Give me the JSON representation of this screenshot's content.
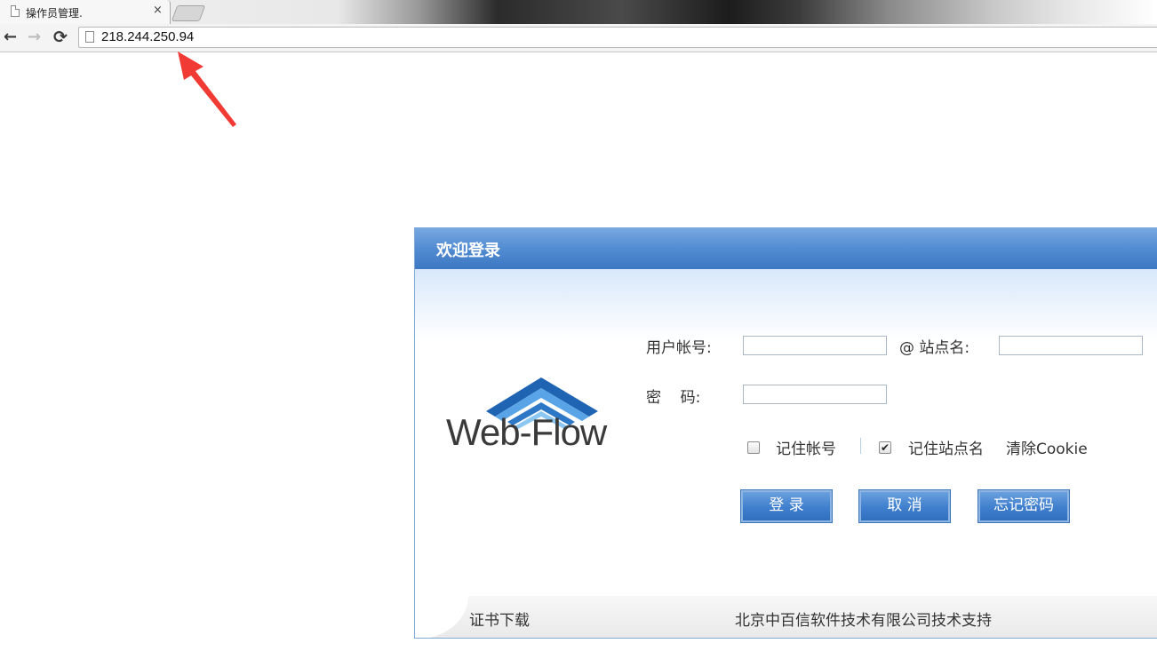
{
  "browser": {
    "tab_title": "操作员管理.",
    "tab_close": "×",
    "url": "218.244.250.94",
    "back_glyph": "←",
    "forward_glyph": "→",
    "reload_glyph": "⟳"
  },
  "login": {
    "title": "欢迎登录",
    "logo_text": "Web-Flow",
    "account_label": "用户帐号:",
    "site_label": "@ 站点名:",
    "password_label": "密    码:",
    "account_value": "",
    "site_value": "",
    "password_value": "",
    "remember_account_label": "记住帐号",
    "remember_account_checked": false,
    "remember_site_label": "记住站点名",
    "remember_site_checked": true,
    "clear_cookie_label": "清除Cookie",
    "login_button": "登 录",
    "cancel_button": "取 消",
    "forgot_button": "忘记密码",
    "cert_download": "证书下载",
    "credit": "北京中百信软件技术有限公司技术支持"
  },
  "colors": {
    "header_blue": "#4f89d0",
    "button_blue": "#3f7fcd",
    "arrow_red": "#f03a33"
  }
}
